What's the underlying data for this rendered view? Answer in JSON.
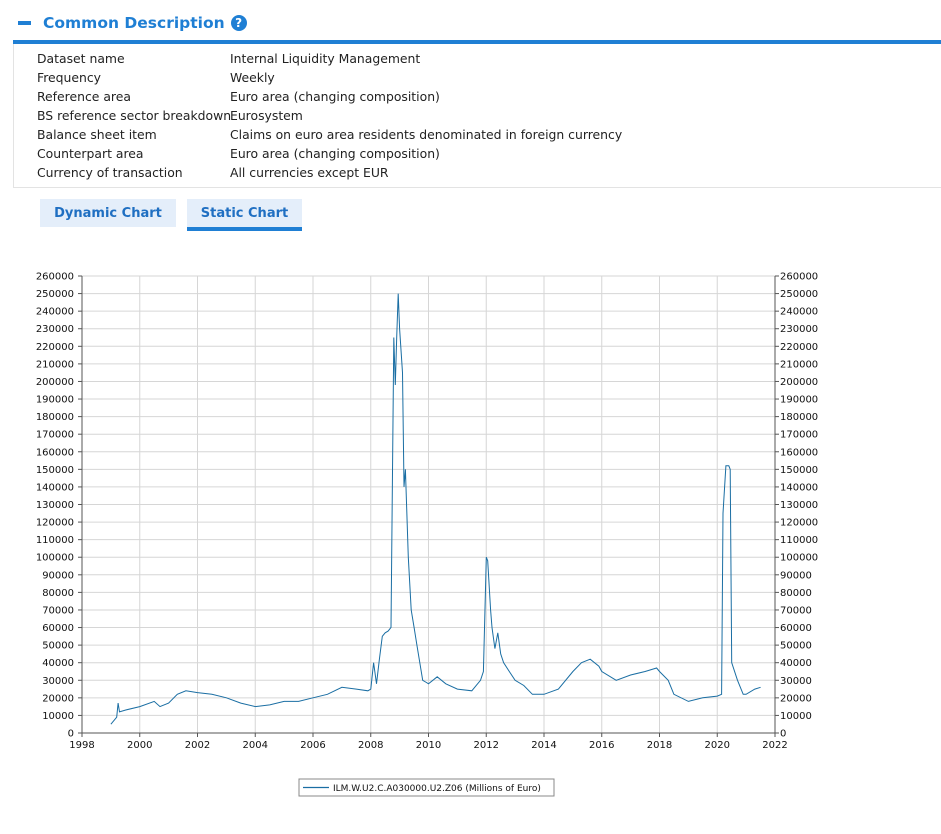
{
  "section": {
    "title": "Common Description",
    "help_glyph": "?"
  },
  "description": [
    {
      "label": "Dataset name",
      "value": "Internal Liquidity Management"
    },
    {
      "label": "Frequency",
      "value": "Weekly"
    },
    {
      "label": "Reference area",
      "value": "Euro area (changing composition)"
    },
    {
      "label": "BS reference sector breakdown",
      "value": "Eurosystem"
    },
    {
      "label": "Balance sheet item",
      "value": "Claims on euro area residents denominated in foreign currency"
    },
    {
      "label": "Counterpart area",
      "value": "Euro area (changing composition)"
    },
    {
      "label": "Currency of transaction",
      "value": "All currencies except EUR"
    }
  ],
  "tabs": [
    {
      "label": "Dynamic Chart",
      "active": false
    },
    {
      "label": "Static Chart",
      "active": true
    }
  ],
  "colors": {
    "accent": "#1f7fd4",
    "tab_bg": "#e4eefa",
    "series": "#1a6ea3",
    "grid": "#d6d6d6"
  },
  "chart_data": {
    "type": "line",
    "xlim": [
      1998,
      2022
    ],
    "ylim": [
      0,
      260000
    ],
    "x_ticks": [
      1998,
      2000,
      2002,
      2004,
      2006,
      2008,
      2010,
      2012,
      2014,
      2016,
      2018,
      2020,
      2022
    ],
    "y_ticks": [
      0,
      10000,
      20000,
      30000,
      40000,
      50000,
      60000,
      70000,
      80000,
      90000,
      100000,
      110000,
      120000,
      130000,
      140000,
      150000,
      160000,
      170000,
      180000,
      190000,
      200000,
      210000,
      220000,
      230000,
      240000,
      250000,
      260000
    ],
    "grid": true,
    "legend_position": "bottom-center",
    "series": [
      {
        "name": "ILM.W.U2.C.A030000.U2.Z06 (Millions of Euro)",
        "x": [
          1999.0,
          1999.2,
          1999.25,
          1999.3,
          1999.5,
          2000.0,
          2000.5,
          2000.7,
          2001.0,
          2001.3,
          2001.6,
          2002.0,
          2002.5,
          2003.0,
          2003.5,
          2004.0,
          2004.5,
          2005.0,
          2005.5,
          2006.0,
          2006.5,
          2007.0,
          2007.5,
          2007.9,
          2008.0,
          2008.1,
          2008.2,
          2008.3,
          2008.4,
          2008.5,
          2008.6,
          2008.7,
          2008.8,
          2008.85,
          2008.9,
          2008.95,
          2009.0,
          2009.1,
          2009.15,
          2009.2,
          2009.3,
          2009.4,
          2009.5,
          2009.6,
          2009.7,
          2009.8,
          2009.9,
          2010.0,
          2010.3,
          2010.6,
          2011.0,
          2011.5,
          2011.8,
          2011.9,
          2012.0,
          2012.05,
          2012.15,
          2012.2,
          2012.3,
          2012.4,
          2012.5,
          2012.6,
          2012.8,
          2013.0,
          2013.3,
          2013.6,
          2014.0,
          2014.5,
          2015.0,
          2015.3,
          2015.6,
          2015.9,
          2016.0,
          2016.5,
          2017.0,
          2017.5,
          2017.9,
          2018.0,
          2018.3,
          2018.5,
          2019.0,
          2019.5,
          2020.0,
          2020.15,
          2020.2,
          2020.3,
          2020.4,
          2020.45,
          2020.5,
          2020.7,
          2020.9,
          2021.0,
          2021.3,
          2021.5
        ],
        "y": [
          5000,
          9000,
          17000,
          12000,
          13000,
          15000,
          18000,
          15000,
          17000,
          22000,
          24000,
          23000,
          22000,
          20000,
          17000,
          15000,
          16000,
          18000,
          18000,
          20000,
          22000,
          26000,
          25000,
          24000,
          25000,
          40000,
          28000,
          42000,
          55000,
          57000,
          58000,
          60000,
          225000,
          198000,
          225000,
          250000,
          230000,
          205000,
          140000,
          150000,
          100000,
          70000,
          60000,
          50000,
          40000,
          30000,
          29000,
          28000,
          32000,
          28000,
          25000,
          24000,
          30000,
          35000,
          100000,
          98000,
          70000,
          60000,
          48000,
          57000,
          45000,
          40000,
          35000,
          30000,
          27000,
          22000,
          22000,
          25000,
          35000,
          40000,
          42000,
          38000,
          35000,
          30000,
          33000,
          35000,
          37000,
          35000,
          30000,
          22000,
          18000,
          20000,
          21000,
          22000,
          125000,
          152000,
          152000,
          150000,
          40000,
          30000,
          22000,
          22000,
          25000,
          26000
        ]
      }
    ]
  }
}
